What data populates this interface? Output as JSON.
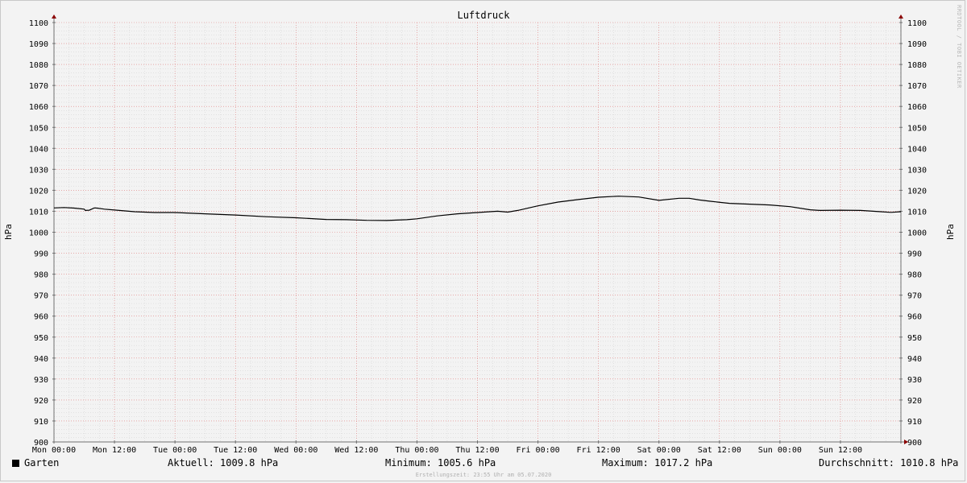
{
  "watermark": "RRDTOOL / TOBI OETIKER",
  "footer": "Erstellungszeit: 23:55 Uhr am 05.07.2020",
  "legend": {
    "series_name": "Garten",
    "series_color": "#000000",
    "current": "Aktuell: 1009.8 hPa",
    "minimum": "Minimum: 1005.6 hPa",
    "maximum": "Maximum: 1017.2 hPa",
    "average": "Durchschnitt: 1010.8 hPa"
  },
  "chart_data": {
    "type": "line",
    "title": "Luftdruck",
    "ylabel": "hPa",
    "ylabel_right": "hPa",
    "ylim": [
      900,
      1100
    ],
    "y_ticks": [
      900,
      910,
      920,
      930,
      940,
      950,
      960,
      970,
      980,
      990,
      1000,
      1010,
      1020,
      1030,
      1040,
      1050,
      1060,
      1070,
      1080,
      1090,
      1100
    ],
    "x_ticks": [
      "Mon 00:00",
      "Mon 12:00",
      "Tue 00:00",
      "Tue 12:00",
      "Wed 00:00",
      "Wed 12:00",
      "Thu 00:00",
      "Thu 12:00",
      "Fri 00:00",
      "Fri 12:00",
      "Sat 00:00",
      "Sat 12:00",
      "Sun 00:00",
      "Sun 12:00"
    ],
    "x_unit": "hours since Mon 00:00",
    "xlim": [
      0,
      168
    ],
    "grid": true,
    "legend_position": "bottom",
    "colors": {
      "line": "#000000",
      "major_grid": "#e07a7a",
      "minor_grid": "#cfcfcf",
      "axis": "#707070",
      "arrow": "#8b0000"
    },
    "series": [
      {
        "name": "Garten",
        "x": [
          0,
          2,
          4,
          6,
          6.2,
          7,
          8,
          8.5,
          10,
          12,
          16,
          20,
          24,
          30,
          36,
          42,
          48,
          54,
          58,
          62,
          66,
          70,
          72,
          76,
          80,
          84,
          88,
          90,
          92,
          96,
          100,
          104,
          108,
          112,
          116,
          120,
          124,
          126,
          128,
          130,
          134,
          138,
          142,
          146,
          150,
          152,
          156,
          160,
          164,
          166,
          168
        ],
        "y": [
          1011.6,
          1011.8,
          1011.5,
          1011,
          1010.4,
          1010.5,
          1011.6,
          1011.5,
          1011,
          1010.6,
          1009.8,
          1009.4,
          1009.4,
          1008.8,
          1008.2,
          1007.4,
          1006.9,
          1006.1,
          1006,
          1005.7,
          1005.6,
          1006,
          1006.4,
          1007.8,
          1008.8,
          1009.4,
          1010,
          1009.6,
          1010.4,
          1012.6,
          1014.4,
          1015.6,
          1016.7,
          1017.2,
          1016.8,
          1015.2,
          1016.2,
          1016.2,
          1015.4,
          1014.8,
          1013.8,
          1013.4,
          1013,
          1012.2,
          1010.7,
          1010.4,
          1010.5,
          1010.4,
          1009.8,
          1009.5,
          1009.8
        ]
      }
    ]
  }
}
